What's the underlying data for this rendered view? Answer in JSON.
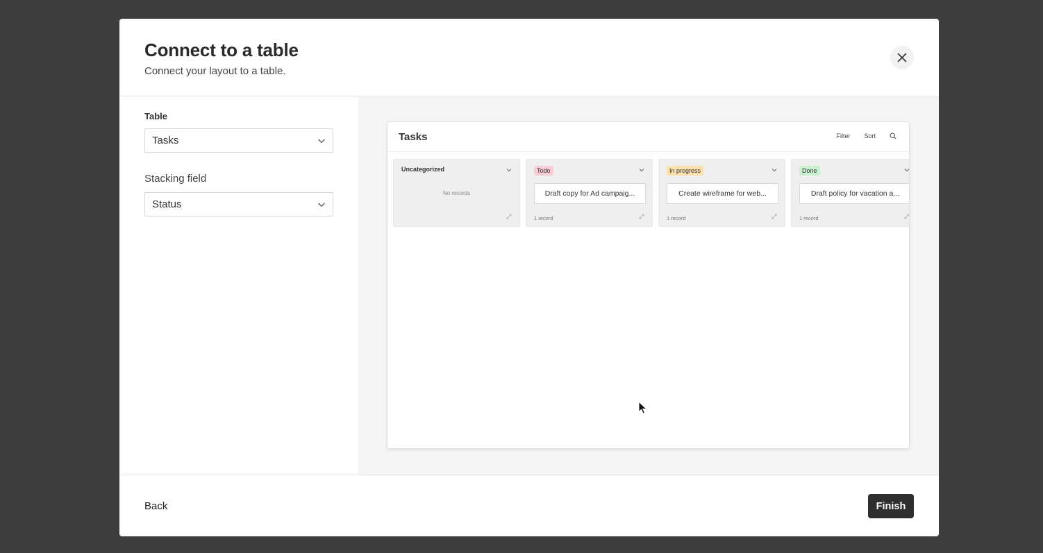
{
  "dialog": {
    "title": "Connect to a table",
    "subtitle": "Connect your layout to a table."
  },
  "form": {
    "table_label": "Table",
    "table_value": "Tasks",
    "stacking_label": "Stacking field",
    "stacking_value": "Status"
  },
  "preview": {
    "title": "Tasks",
    "filter_label": "Filter",
    "sort_label": "Sort",
    "columns": [
      {
        "name": "Uncategorized",
        "empty_text": "No records"
      },
      {
        "name": "Todo",
        "badge_color": "#f9cdd4",
        "card": "Draft copy for Ad campaig...",
        "count": "1 record"
      },
      {
        "name": "In progress",
        "badge_color": "#fde2b0",
        "card": "Create wireframe for web...",
        "count": "1 record"
      },
      {
        "name": "Done",
        "badge_color": "#c9f0cf",
        "card": "Draft policy for vacation a...",
        "count": "1 record"
      }
    ]
  },
  "footer": {
    "back_label": "Back",
    "finish_label": "Finish"
  }
}
